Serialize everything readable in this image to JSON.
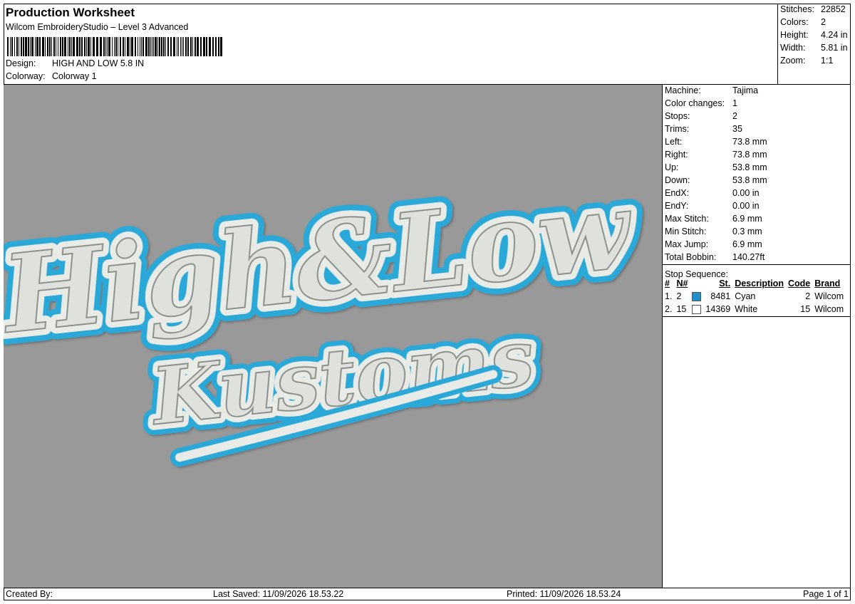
{
  "header": {
    "title": "Production Worksheet",
    "software": "Wilcom EmbroideryStudio – Level 3 Advanced",
    "design_label": "Design:",
    "design_value": "HIGH AND LOW 5.8 IN",
    "colorway_label": "Colorway:",
    "colorway_value": "Colorway 1"
  },
  "stats": [
    {
      "label": "Stitches:",
      "value": "22852"
    },
    {
      "label": "Colors:",
      "value": "2"
    },
    {
      "label": "Height:",
      "value": "4.24 in"
    },
    {
      "label": "Width:",
      "value": "5.81 in"
    },
    {
      "label": "Zoom:",
      "value": "1:1"
    }
  ],
  "machine_info": [
    {
      "label": "Machine:",
      "value": "Tajima"
    },
    {
      "label": "Color changes:",
      "value": "1"
    },
    {
      "label": "Stops:",
      "value": "2"
    },
    {
      "label": "Trims:",
      "value": "35"
    },
    {
      "label": "Left:",
      "value": "73.8 mm"
    },
    {
      "label": "Right:",
      "value": "73.8 mm"
    },
    {
      "label": "Up:",
      "value": "53.8 mm"
    },
    {
      "label": "Down:",
      "value": "53.8 mm"
    },
    {
      "label": "EndX:",
      "value": "0.00 in"
    },
    {
      "label": "EndY:",
      "value": "0.00 in"
    },
    {
      "label": "Max Stitch:",
      "value": "6.9 mm"
    },
    {
      "label": "Min Stitch:",
      "value": "0.3 mm"
    },
    {
      "label": "Max Jump:",
      "value": "6.9 mm"
    },
    {
      "label": "Total Bobbin:",
      "value": "140.27ft"
    }
  ],
  "stop_sequence": {
    "title": "Stop Sequence:",
    "columns": [
      "#",
      "N#",
      "St.",
      "Description",
      "Code",
      "Brand"
    ],
    "rows": [
      {
        "index": "1.",
        "n": "2",
        "swatch": "#1e90d0",
        "stitches": "8481",
        "description": "Cyan",
        "code": "2",
        "brand": "Wilcom"
      },
      {
        "index": "2.",
        "n": "15",
        "swatch": "#ffffff",
        "stitches": "14369",
        "description": "White",
        "code": "15",
        "brand": "Wilcom"
      }
    ]
  },
  "design_art": {
    "line1": "High&Low",
    "line2": "Kustoms",
    "outline_color": "#29a9d9",
    "fill_color": "#e9ece6",
    "background": "#999999"
  },
  "footer": {
    "created_by": "Created By:",
    "last_saved": "Last Saved: 11/09/2026 18.53.22",
    "printed": "Printed: 11/09/2026 18.53.24",
    "page": "Page 1 of 1"
  }
}
